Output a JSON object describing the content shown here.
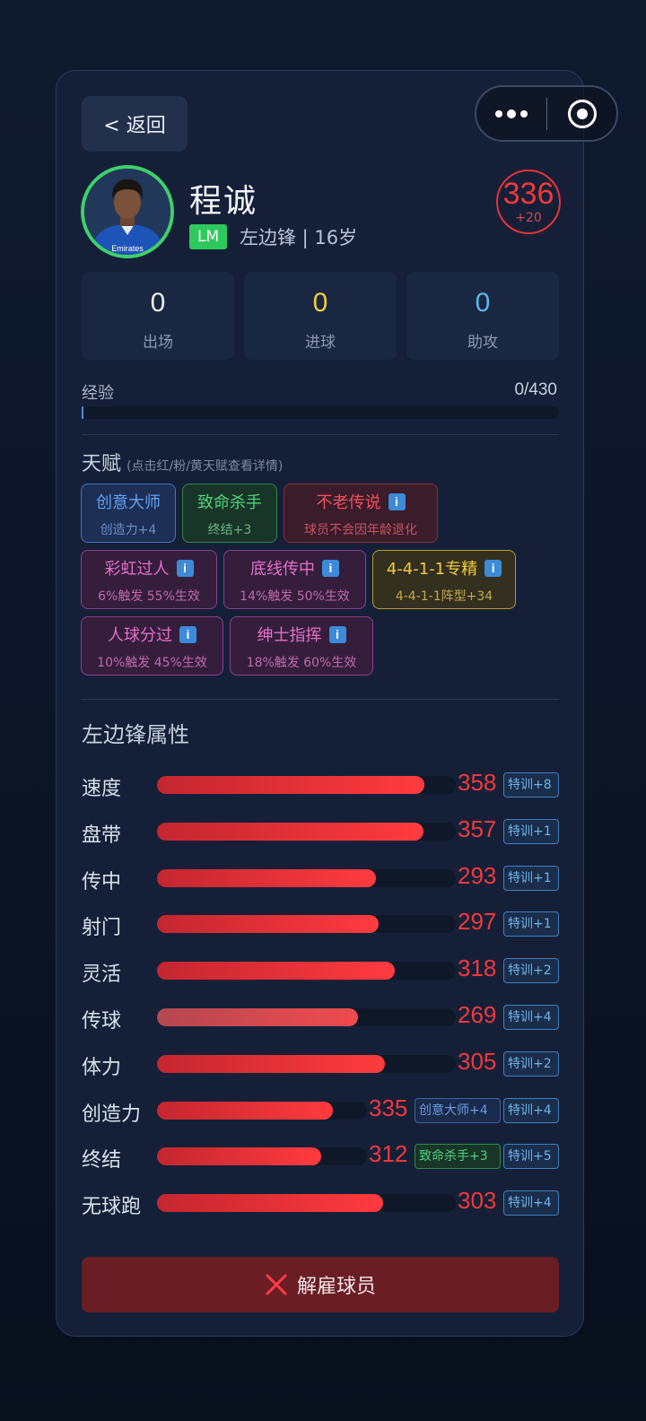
{
  "nav": {
    "back_label": "< 返回"
  },
  "player": {
    "name": "程诚",
    "position_code": "LM",
    "position_desc": "左边锋 | 16岁",
    "rating": "336",
    "rating_delta": "+20",
    "avatar_shirt_text": "Emirates"
  },
  "stats": [
    {
      "value": "0",
      "label": "出场",
      "color": "#e6ecf5"
    },
    {
      "value": "0",
      "label": "进球",
      "color": "#f5cd40"
    },
    {
      "value": "0",
      "label": "助攻",
      "color": "#5bb6f0"
    }
  ],
  "experience": {
    "label": "经验",
    "value": "0/430",
    "progress": 0
  },
  "talents": {
    "title": "天赋",
    "hint": "(点击红/粉/黄天赋查看详情)",
    "info_glyph": "i",
    "items": [
      {
        "name": "创意大师",
        "desc": "创造力+4",
        "color": "blue",
        "info": false
      },
      {
        "name": "致命杀手",
        "desc": "终结+3",
        "color": "green",
        "info": false
      },
      {
        "name": "不老传说",
        "desc": "球员不会因年龄退化",
        "color": "red",
        "info": true
      },
      {
        "name": "彩虹过人",
        "desc": "6%触发 55%生效",
        "color": "pink",
        "info": true
      },
      {
        "name": "底线传中",
        "desc": "14%触发 50%生效",
        "color": "pink",
        "info": true
      },
      {
        "name": "4-4-1-1专精",
        "desc": "4-4-1-1阵型+34",
        "color": "yellow",
        "info": true
      },
      {
        "name": "人球分过",
        "desc": "10%触发 45%生效",
        "color": "pink",
        "info": true
      },
      {
        "name": "绅士指挥",
        "desc": "18%触发 60%生效",
        "color": "pink",
        "info": true
      }
    ]
  },
  "attributes": {
    "title": "左边锋属性",
    "scale_max": 400,
    "items": [
      {
        "name": "速度",
        "value": 358,
        "badges": [
          {
            "text": "特训+8",
            "type": "train"
          }
        ]
      },
      {
        "name": "盘带",
        "value": 357,
        "badges": [
          {
            "text": "特训+1",
            "type": "train"
          }
        ]
      },
      {
        "name": "传中",
        "value": 293,
        "badges": [
          {
            "text": "特训+1",
            "type": "train"
          }
        ]
      },
      {
        "name": "射门",
        "value": 297,
        "badges": [
          {
            "text": "特训+1",
            "type": "train"
          }
        ]
      },
      {
        "name": "灵活",
        "value": 318,
        "badges": [
          {
            "text": "特训+2",
            "type": "train"
          }
        ]
      },
      {
        "name": "传球",
        "value": 269,
        "badges": [
          {
            "text": "特训+4",
            "type": "train"
          }
        ]
      },
      {
        "name": "体力",
        "value": 305,
        "badges": [
          {
            "text": "特训+2",
            "type": "train"
          }
        ]
      },
      {
        "name": "创造力",
        "value": 335,
        "badges": [
          {
            "text": "创意大师+4",
            "type": "bonus-blue"
          },
          {
            "text": "特训+4",
            "type": "train"
          }
        ]
      },
      {
        "name": "终结",
        "value": 312,
        "badges": [
          {
            "text": "致命杀手+3",
            "type": "bonus-green"
          },
          {
            "text": "特训+5",
            "type": "train"
          }
        ]
      },
      {
        "name": "无球跑",
        "value": 303,
        "badges": [
          {
            "text": "特训+4",
            "type": "train"
          }
        ]
      }
    ]
  },
  "actions": {
    "fire_label": "解雇球员"
  },
  "colors": {
    "accent_red": "#f0383c",
    "accent_green": "#2ec95c",
    "card_bg": "#152038"
  },
  "icons": [
    "more-dots-icon",
    "target-icon",
    "close-x-icon",
    "info-icon"
  ]
}
